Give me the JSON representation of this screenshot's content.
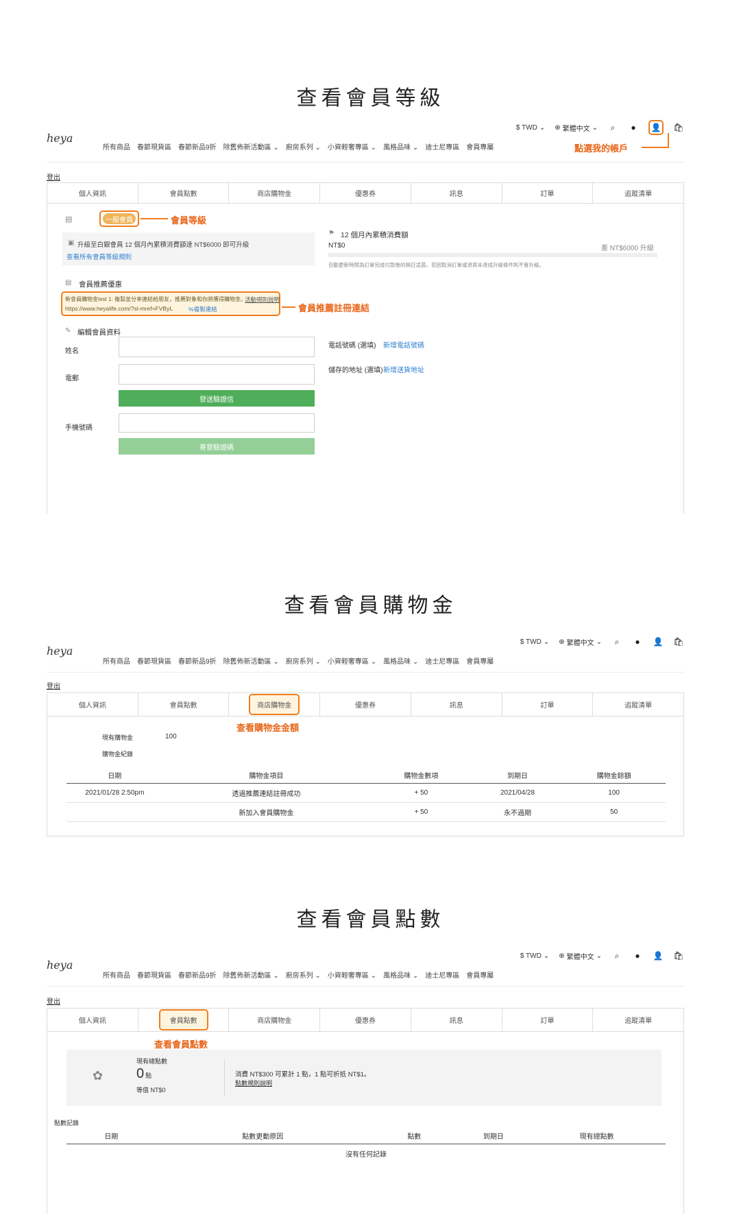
{
  "header": {
    "currency": "$ TWD",
    "language": "繁體中文",
    "logo": "heya",
    "nav": [
      "所有商品",
      "春節現貨區",
      "春節新品9折",
      "除舊佈新活動區",
      "廚房系列",
      "小資輕奢專區",
      "風格品味",
      "迪士尼專區",
      "會員專屬"
    ],
    "nav_dropdown": [
      false,
      false,
      false,
      true,
      true,
      true,
      true,
      false,
      false
    ],
    "logout": "登出"
  },
  "tabs": [
    "個人資訊",
    "會員點數",
    "商店購物金",
    "優惠券",
    "訊息",
    "訂單",
    "追蹤清單"
  ],
  "section1": {
    "title": "查看會員等級",
    "account_note": "點選我的帳戶",
    "level_badge": "一般會員",
    "level_note": "會員等級",
    "upgrade_text": "升級至白銀會員 12 個月內累積消費額達 NT$6000 即可升級",
    "rules_link": "查看所有會員等級規則",
    "accum_title": "12 個月內累積消費額",
    "accum_value": "NT$0",
    "accum_gap": "差 NT$6000 升級",
    "accum_note": "自動更新時間為訂單完成付款後的隔日凌晨，若因取消訂單或退貨未達成升級條件則不會升級。",
    "referral_title": "會員推薦優惠",
    "referral_text": "新會員購物金test 1: 複製並分享連結給朋友，推薦對象和你將獲得購物金。",
    "referral_rules": "活動規則說明",
    "referral_url": "https://www.heyalife.com/?sl-mref=FVByL",
    "copy_link": "複製連結",
    "referral_note": "會員推薦註冊連結",
    "edit_title": "編輯會員資料",
    "name_label": "姓名",
    "email_label": "電郵",
    "send_btn": "發送驗證信",
    "phone_label": "手機號碼",
    "resend_btn": "寄發驗證碼",
    "tel_label": "電話號碼 (選填)",
    "tel_link": "新增電話號碼",
    "addr_label": "儲存的地址 (選填)",
    "addr_link": "新增送貨地址"
  },
  "section2": {
    "title": "查看會員購物金",
    "tab_note": "查看購物金金額",
    "owned_label": "現有購物金",
    "owned_value": "100",
    "history_label": "購物金紀錄",
    "columns": [
      "日期",
      "購物金項目",
      "購物金數項",
      "到期日",
      "購物金餘額"
    ],
    "rows": [
      [
        "2021/01/28 2:50pm",
        "透過推薦連結註冊成功",
        "+ 50",
        "2021/04/28",
        "100"
      ],
      [
        "",
        "新加入會員購物金",
        "+ 50",
        "永不過期",
        "50"
      ]
    ]
  },
  "section3": {
    "title": "查看會員點數",
    "tab_note": "查看會員點數",
    "total_label": "現有總點數",
    "total_value": "0",
    "unit": "點",
    "equiv": "等值 NT$0",
    "rule_text": "消費 NT$300 可累計 1 點，1 點可折抵 NT$1。",
    "rule_link": "點數規則說明",
    "history_label": "點數記錄",
    "columns": [
      "日期",
      "點數更動原因",
      "點數",
      "到期日",
      "現有總點數"
    ],
    "empty": "沒有任何記錄"
  },
  "colors": {
    "accent": "#ef7d1c",
    "green": "#4fae5a",
    "badge": "#efb55b",
    "link": "#2f7fcf"
  }
}
